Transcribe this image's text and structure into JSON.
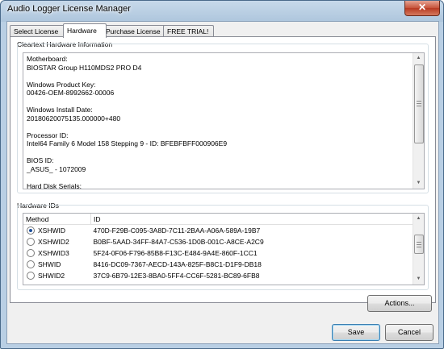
{
  "window": {
    "title": "Audio Logger License Manager",
    "close_glyph": "✕"
  },
  "tabs": [
    {
      "label": "Select License"
    },
    {
      "label": "Hardware"
    },
    {
      "label": "Purchase License"
    },
    {
      "label": "FREE TRIAL!"
    }
  ],
  "hardware_info": {
    "group_label": "Cleartext Hardware Information",
    "lines": [
      "Motherboard:",
      "BIOSTAR Group H110MDS2 PRO D4",
      "",
      "Windows Product Key:",
      "00426-OEM-8992662-00006",
      "",
      "Windows Install Date:",
      "20180620075135.000000+480",
      "",
      "Processor ID:",
      "Intel64 Family 6 Model 158 Stepping 9 - ID: BFEBFBFF000906E9",
      "",
      "BIOS ID:",
      "_ASUS_ - 1072009",
      "",
      "Hard Disk Serials:"
    ]
  },
  "hardware_ids": {
    "group_label": "Hardware IDs",
    "columns": [
      "Method",
      "ID"
    ],
    "rows": [
      {
        "method": "XSHWID",
        "id": "470D-F29B-C095-3A8D-7C11-2BAA-A06A-589A-19B7",
        "selected": true
      },
      {
        "method": "XSHWID2",
        "id": "B0BF-5AAD-34FF-84A7-C536-1D0B-001C-A8CE-A2C9",
        "selected": false
      },
      {
        "method": "XSHWID3",
        "id": "5F24-0F06-F796-85B8-F13C-E484-9A4E-860F-1CC1",
        "selected": false
      },
      {
        "method": "SHWID",
        "id": "8416-DC09-7367-AECD-143A-825F-B8C1-D1F9-DB18",
        "selected": false
      },
      {
        "method": "SHWID2",
        "id": "37C9-6B79-12E3-8BA0-5FF4-CC6F-5281-BC89-6FB8",
        "selected": false
      }
    ]
  },
  "buttons": {
    "actions": "Actions...",
    "save": "Save",
    "cancel": "Cancel"
  }
}
